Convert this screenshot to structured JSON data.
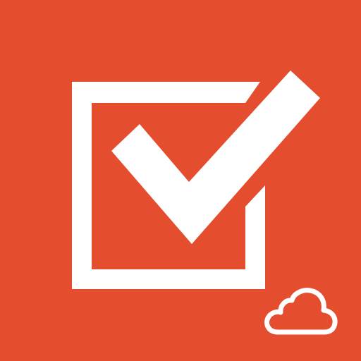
{
  "icon": {
    "name": "checkbox-cloud-app-icon",
    "background_color": "#E44D2E",
    "foreground_color": "#FFFFFF",
    "glyphs": [
      "checkbox-frame-icon",
      "checkmark-icon",
      "cloud-icon"
    ]
  }
}
